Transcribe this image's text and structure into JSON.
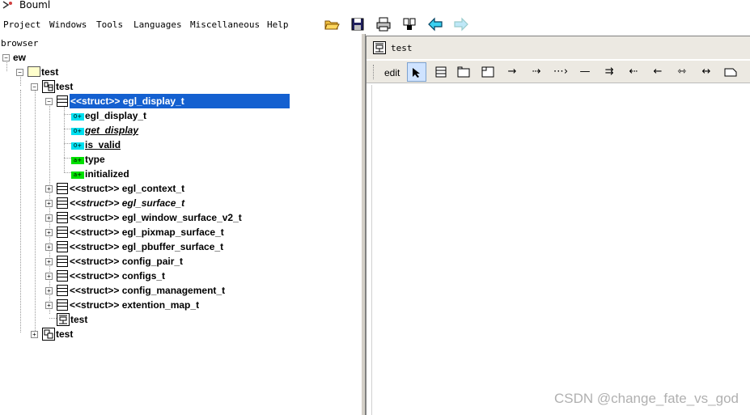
{
  "window": {
    "title": "Bouml"
  },
  "menu": [
    "Project",
    "Windows",
    "Tools",
    "Languages",
    "Miscellaneous",
    "Help"
  ],
  "toolbar_icons": [
    "open-folder-icon",
    "save-icon",
    "print-icon",
    "search-icon",
    "back-arrow-icon",
    "forward-arrow-icon"
  ],
  "browser": {
    "label": "browser",
    "root": "ew",
    "package": "test",
    "class_view": "test",
    "selected_struct": "<<struct>> egl_display_t",
    "members": [
      {
        "kind": "operation",
        "icon_text": "0+",
        "label": "egl_display_t",
        "underline": false,
        "italic": false
      },
      {
        "kind": "operation",
        "icon_text": "0+",
        "label": "get_display",
        "underline": true,
        "italic": true
      },
      {
        "kind": "operation",
        "icon_text": "0+",
        "label": "is_valid",
        "underline": true,
        "italic": false
      },
      {
        "kind": "attribute",
        "icon_text": "a+",
        "label": "type",
        "underline": false,
        "italic": false
      },
      {
        "kind": "attribute",
        "icon_text": "a+",
        "label": "initialized",
        "underline": false,
        "italic": false
      }
    ],
    "structs": [
      {
        "label": "<<struct>> egl_context_t",
        "italic": false
      },
      {
        "label": "<<struct>> egl_surface_t",
        "italic": true
      },
      {
        "label": "<<struct>> egl_window_surface_v2_t",
        "italic": false
      },
      {
        "label": "<<struct>> egl_pixmap_surface_t",
        "italic": false
      },
      {
        "label": "<<struct>> egl_pbuffer_surface_t",
        "italic": false
      },
      {
        "label": "<<struct>> config_pair_t",
        "italic": false
      },
      {
        "label": "<<struct>> configs_t",
        "italic": false
      },
      {
        "label": "<<struct>> config_management_t",
        "italic": false
      },
      {
        "label": "<<struct>> extention_map_t",
        "italic": false
      }
    ],
    "diagram_item": "test",
    "deployment_view": "test"
  },
  "diagram": {
    "title": "test",
    "edit_label": "edit",
    "tools": [
      "select-arrow-icon",
      "class-icon",
      "package-icon",
      "note-icon",
      "association-arrow-icon",
      "dependency-arrow-icon",
      "realization-arrow-icon",
      "line-icon",
      "inheritance-arrow-icon",
      "left-arrow-icon",
      "left-filled-arrow-icon",
      "bidirectional-arrow-icon",
      "bidirectional-filled-arrow-icon",
      "anchor-icon"
    ]
  },
  "watermark": "CSDN @change_fate_vs_god",
  "colors": {
    "selection": "#1460d0",
    "operation_icon": "#00e0f0",
    "attribute_icon": "#00e000",
    "folder": "#ffffcc"
  }
}
